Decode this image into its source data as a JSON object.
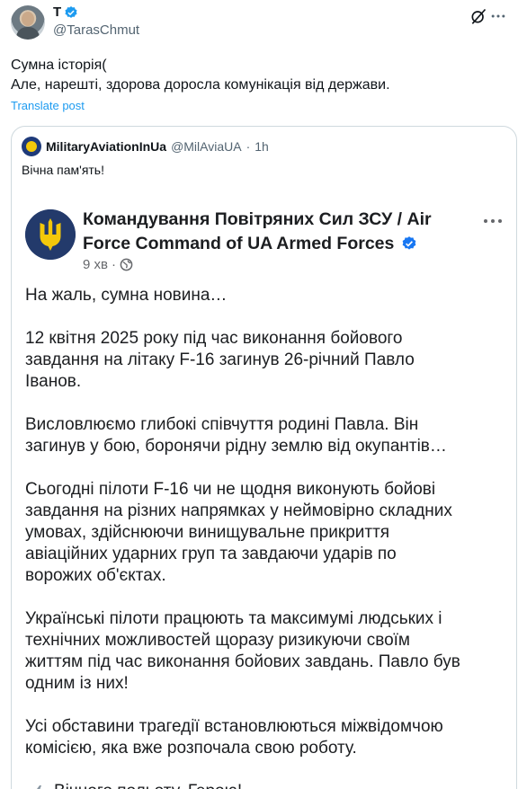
{
  "author": {
    "display_name": "T",
    "handle": "@TarasChmut"
  },
  "tweet": {
    "lines": [
      "Сумна історія(",
      "Але, нарешті, здорова доросла комунікація від держави."
    ],
    "translate_label": "Translate post"
  },
  "quote": {
    "name": "MilitaryAviationInUa",
    "handle": "@MilAviaUA",
    "separator": "·",
    "time": "1h",
    "text": "Вічна пам'ять!"
  },
  "fb_post": {
    "title_line1": "Командування Повітряних Сил ЗСУ / Air",
    "title_line2": "Force Command of UA Armed Forces",
    "time": "9 хв",
    "separator": "·",
    "paragraphs": [
      [
        "На жаль, сумна новина…"
      ],
      [
        "12 квітня 2025 року під час виконання бойового",
        "завдання на літаку F-16 загинув 26-річний Павло",
        "Іванов."
      ],
      [
        "Висловлюємо глибокі співчуття родині Павла. Він",
        "загинув у бою, боронячи рідну землю від окупантів…"
      ],
      [
        "Сьогодні пілоти F-16 чи не щодня виконують бойові",
        "завдання на різних напрямках у неймовірно складних",
        "умовах, здійснюючи винищувальне прикриття",
        "авіаційних ударних груп та завдаючи ударів по",
        "ворожих об'єктах."
      ],
      [
        "Українські пілоти працюють та максимумі людських і",
        "технічних можливостей щоразу ризикуючи своїм",
        "життям під час виконання бойових завдань. Павло був",
        "одним із них!"
      ],
      [
        "Усі обставини трагедії встановлюються міжвідомчою",
        "комісією, яка вже розпочала свою роботу."
      ]
    ],
    "closing": "Вічного польоту, Герою!"
  },
  "icons": {
    "verified": "verified-badge-icon",
    "grok": "grok-icon",
    "more": "more-icon",
    "globe": "globe-icon",
    "plane": "airplane-icon",
    "trident": "trident-icon"
  },
  "colors": {
    "accent": "#1d9bf0",
    "text": "#0f1419",
    "muted": "#536471",
    "fb_text": "#1c1e21",
    "fb_muted": "#65676b",
    "border": "#cfd9de"
  }
}
